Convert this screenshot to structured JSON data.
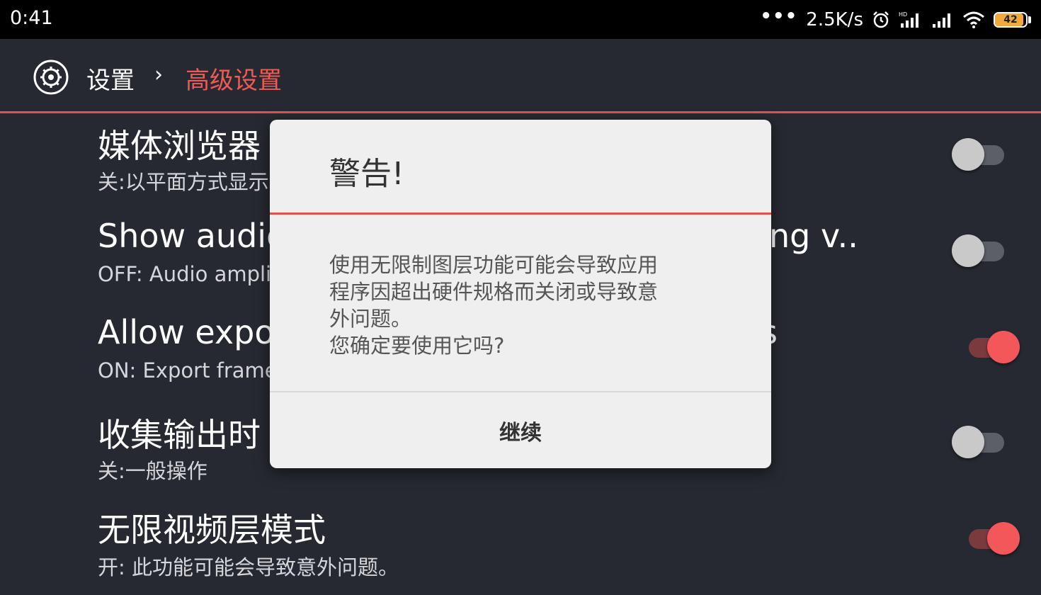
{
  "status_bar": {
    "time": "0:41",
    "dots": "•••",
    "net_speed": "2.5K/s",
    "battery_level": "42",
    "icons": [
      "alarm-icon",
      "hd-signal-icon",
      "signal-icon",
      "wifi-icon",
      "battery-icon"
    ]
  },
  "header": {
    "root_label": "设置",
    "separator": "›",
    "current_label": "高级设置",
    "accent_color": "#e4514f"
  },
  "settings": [
    {
      "title": "媒体浏览器",
      "subtitle": "关:以平面方式显示",
      "state": "off"
    },
    {
      "title": "Show audio",
      "title_right": "ng v..",
      "subtitle": "OFF: Audio amplit",
      "state": "off"
    },
    {
      "title": "Allow expo",
      "title_right": "s",
      "subtitle": "ON: Export frame",
      "state": "on"
    },
    {
      "title": "收集输出时",
      "subtitle": "关:一般操作",
      "state": "off"
    },
    {
      "title": "无限视频层模式",
      "subtitle": "开: 此功能可能会导致意外问题。",
      "state": "on"
    }
  ],
  "dialog": {
    "title": "警告!",
    "message_lines": [
      "使用无限制图层功能可能会导致应用",
      "程序因超出硬件规格而关闭或导致意",
      "外问题。",
      "您确定要使用它吗?"
    ],
    "button_label": "继续"
  }
}
